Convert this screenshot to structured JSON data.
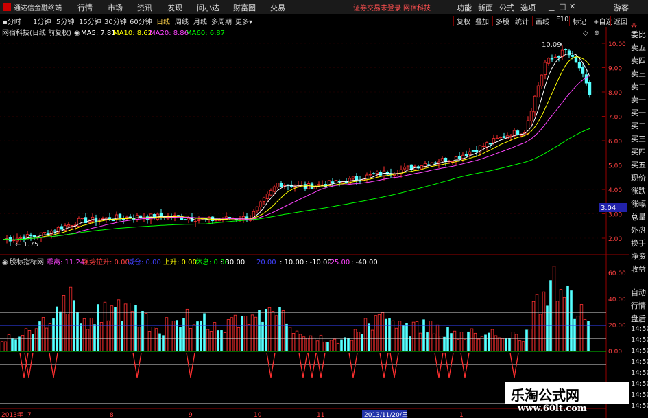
{
  "menubar": {
    "app_title": "通达信金融终端",
    "items": [
      "行情",
      "市场",
      "资讯",
      "发现",
      "问小达",
      "财富圈",
      "交易"
    ],
    "notice": "证券交易未登录",
    "stock_tag": "网宿科技",
    "right_items": [
      "功能",
      "新面",
      "公式",
      "选项"
    ],
    "guest": "游客"
  },
  "toolbar": {
    "periods": [
      "分时",
      "1分钟",
      "5分钟",
      "15分钟",
      "30分钟",
      "60分钟",
      "日线",
      "周线",
      "月线",
      "多周期",
      "更多"
    ],
    "active_period": "日线",
    "right_items": [
      "复权",
      "叠加",
      "多股",
      "统计",
      "画线",
      "F10",
      "标记",
      "+自选",
      "返回"
    ]
  },
  "main_chart": {
    "title": "网宿科技(日线 前复权)",
    "legend": [
      {
        "label": "MA5: 7.81",
        "color": "#ffffff"
      },
      {
        "label": "MA10: 8.62",
        "color": "#ffff00"
      },
      {
        "label": "MA20: 8.86",
        "color": "#ff44ff"
      },
      {
        "label": "MA60: 6.87",
        "color": "#00ff00"
      }
    ],
    "y_ticks": [
      "10.00",
      "9.00",
      "8.00",
      "7.00",
      "6.00",
      "5.00",
      "4.00",
      "3.00",
      "2.00"
    ],
    "high_label": "10.09",
    "low_label": "1.75",
    "price_tag": "3.04"
  },
  "indicator": {
    "title": "股标指标网",
    "values": [
      {
        "text": "乖离: 11.24",
        "color": "#ff44ff"
      },
      {
        "text": "强势拉升: 0.00",
        "color": "#ff4040"
      },
      {
        "text": "减仓: 0.00",
        "color": "#4040ff"
      },
      {
        "text": "上升: 0.00",
        "color": "#ffff00"
      },
      {
        "text": "休息: 0.00",
        "color": "#00ff00"
      },
      {
        "text": ": 30.00",
        "color": "#ffffff"
      },
      {
        "text": "20.00",
        "color": "#4040ff"
      },
      {
        "text": ": 10.00",
        "color": "#ffffff"
      },
      {
        "text": ": -10.00",
        "color": "#ffffff"
      },
      {
        "text": "-25.00",
        "color": "#ff44ff"
      },
      {
        "text": ": -40.00",
        "color": "#ffffff"
      }
    ],
    "y_ticks": [
      "60.00",
      "40.00",
      "20.00",
      "0.00"
    ]
  },
  "time_axis": {
    "labels": [
      "2013年",
      "7",
      "8",
      "9",
      "10",
      "11",
      "2013/11/20/三",
      "1"
    ]
  },
  "right_panel": {
    "items": [
      "委比",
      "卖五",
      "卖四",
      "卖三",
      "卖二",
      "卖一",
      "买一",
      "买二",
      "买三",
      "买四",
      "买五",
      "现价",
      "涨跌",
      "涨幅",
      "总量",
      "外盘",
      "换手",
      "净资",
      "收益",
      "自动",
      "行情",
      "盘后"
    ],
    "times": [
      "14:50",
      "14:50",
      "14:50",
      "14:50",
      "14:50",
      "14:50",
      "14:50",
      "14:50"
    ]
  },
  "watermark": {
    "cn": "乐淘公式网",
    "url": "www.60lt.com"
  }
}
